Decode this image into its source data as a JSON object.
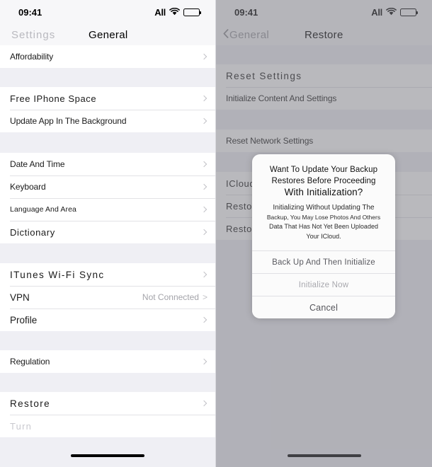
{
  "status_bar": {
    "time": "09:41",
    "carrier": "All",
    "wifi_icon": "wifi-icon",
    "battery_icon": "battery-full-icon"
  },
  "left_screen": {
    "nav": {
      "back_label": "Settings",
      "title": "General"
    },
    "sections": [
      {
        "rows": [
          {
            "label": "Affordability",
            "value": "",
            "style": "t-narrow"
          }
        ]
      },
      {
        "rows": [
          {
            "label": "Free IPhone Space",
            "value": "",
            "style": "t-wide"
          },
          {
            "label": "Update App In The Background",
            "value": "",
            "style": "t-narrow"
          }
        ]
      },
      {
        "rows": [
          {
            "label": "Date And Time",
            "value": "",
            "style": "t-narrow"
          },
          {
            "label": "Keyboard",
            "value": "",
            "style": "t-narrow"
          },
          {
            "label": "Language And Area",
            "value": "",
            "style": "t-tiny"
          },
          {
            "label": "Dictionary",
            "value": "",
            "style": "t-wide"
          }
        ]
      },
      {
        "rows": [
          {
            "label": "ITunes Wi-Fi Sync",
            "value": "",
            "style": "t-xwide"
          },
          {
            "label": "VPN",
            "value": "Not Connected",
            "style": "t-big"
          },
          {
            "label": "Profile",
            "value": "",
            "style": "t-big"
          }
        ]
      },
      {
        "rows": [
          {
            "label": "Regulation",
            "value": "",
            "style": "t-narrow"
          }
        ]
      },
      {
        "rows": [
          {
            "label": "Restore",
            "value": "",
            "style": "t-xwide"
          },
          {
            "label": "Turn",
            "value": "",
            "style": "t-ghost"
          }
        ]
      }
    ]
  },
  "right_screen": {
    "nav": {
      "back_label": "General",
      "title": "Restore"
    },
    "sections": [
      {
        "rows": [
          {
            "label": "Reset Settings",
            "value": "",
            "style": "t-xwide"
          },
          {
            "label": "Initialize Content And Settings",
            "value": "",
            "style": "t-narrow"
          }
        ]
      },
      {
        "rows": [
          {
            "label": "Reset Network Settings",
            "value": "",
            "style": "t-narrow"
          }
        ]
      },
      {
        "rows": [
          {
            "label": "ICloud Restore",
            "value": "",
            "style": "t-wide"
          },
          {
            "label": "Restores",
            "value": "",
            "style": "t-wide"
          },
          {
            "label": "Restores",
            "value": "",
            "style": "t-wide"
          }
        ]
      }
    ]
  },
  "alert": {
    "title_line1": "Want To Update Your Backup",
    "title_line2": "Restores Before Proceeding",
    "title_line3": "With Initialization?",
    "message_line1": "Initializing Without Updating The",
    "message_line2": "Backup, You May Lose Photos And Others",
    "message_line3": "Data That Has Not Yet Been Uploaded",
    "message_line4": "Your ICloud.",
    "buttons": [
      {
        "label": "Back Up And Then Initialize"
      },
      {
        "label": "Initialize Now"
      },
      {
        "label": "Cancel"
      }
    ]
  },
  "colors": {
    "screen_bg": "#efeff4",
    "row_bg": "#ffffff",
    "separator": "#e2e2e6",
    "dim_overlay": "#919195",
    "chevron": "#c2c2c7",
    "secondary_text": "#a4a4aa"
  }
}
